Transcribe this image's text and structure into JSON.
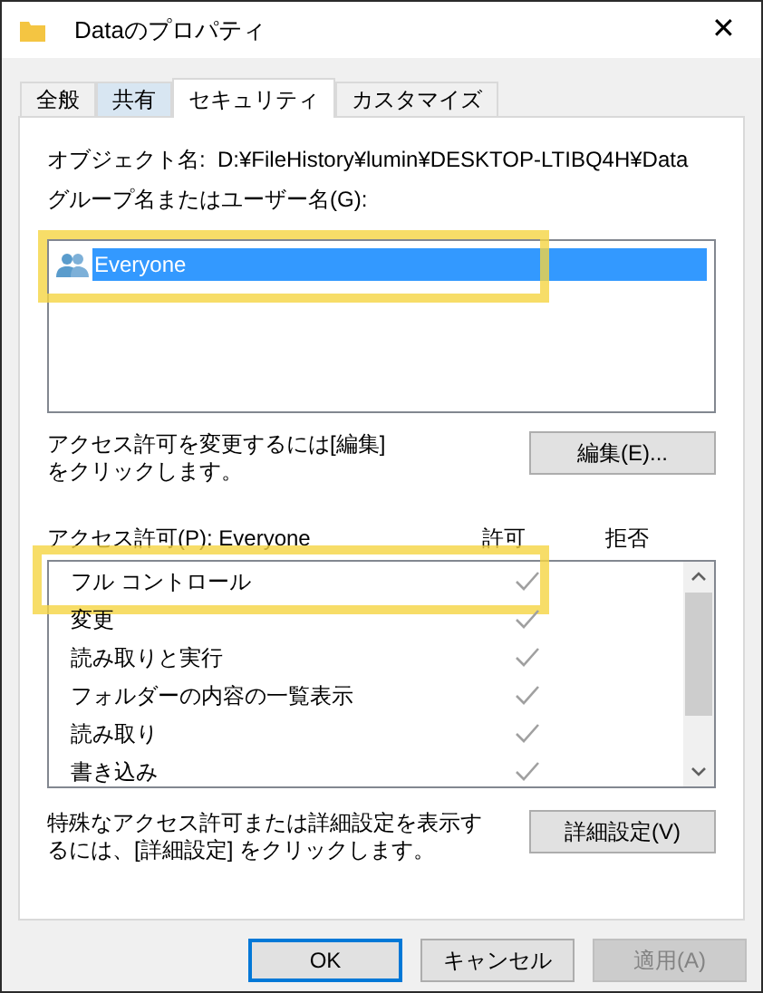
{
  "window": {
    "title": "Dataのプロパティ",
    "close": "✕"
  },
  "tabs": [
    {
      "label": "全般",
      "selected": false,
      "hover": false
    },
    {
      "label": "共有",
      "selected": false,
      "hover": true
    },
    {
      "label": "セキュリティ",
      "selected": true,
      "hover": false
    },
    {
      "label": "カスタマイズ",
      "selected": false,
      "hover": false
    }
  ],
  "object": {
    "label": "オブジェクト名:",
    "value": "D:¥FileHistory¥lumin¥DESKTOP-LTIBQ4H¥Data"
  },
  "users": {
    "label": "グループ名またはユーザー名(G):",
    "items": [
      {
        "name": "Everyone",
        "selected": true,
        "highlighted": true
      }
    ]
  },
  "edit": {
    "text": "アクセス許可を変更するには[編集]をクリックします。",
    "button": "編集(E)..."
  },
  "permissions": {
    "label": "アクセス許可(P): Everyone",
    "allow_header": "許可",
    "deny_header": "拒否",
    "rows": [
      {
        "name": "フル コントロール",
        "allow": true,
        "deny": false,
        "highlighted": true
      },
      {
        "name": "変更",
        "allow": true,
        "deny": false,
        "highlighted": false
      },
      {
        "name": "読み取りと実行",
        "allow": true,
        "deny": false,
        "highlighted": false
      },
      {
        "name": "フォルダーの内容の一覧表示",
        "allow": true,
        "deny": false,
        "highlighted": false
      },
      {
        "name": "読み取り",
        "allow": true,
        "deny": false,
        "highlighted": false
      },
      {
        "name": "書き込み",
        "allow": true,
        "deny": false,
        "highlighted": false
      }
    ]
  },
  "advanced": {
    "text": "特殊なアクセス許可または詳細設定を表示するには、[詳細設定] をクリックします。",
    "button": "詳細設定(V)"
  },
  "buttons": [
    {
      "label": "OK",
      "default": true,
      "disabled": false
    },
    {
      "label": "キャンセル",
      "default": false,
      "disabled": false
    },
    {
      "label": "適用(A)",
      "default": false,
      "disabled": true
    }
  ]
}
